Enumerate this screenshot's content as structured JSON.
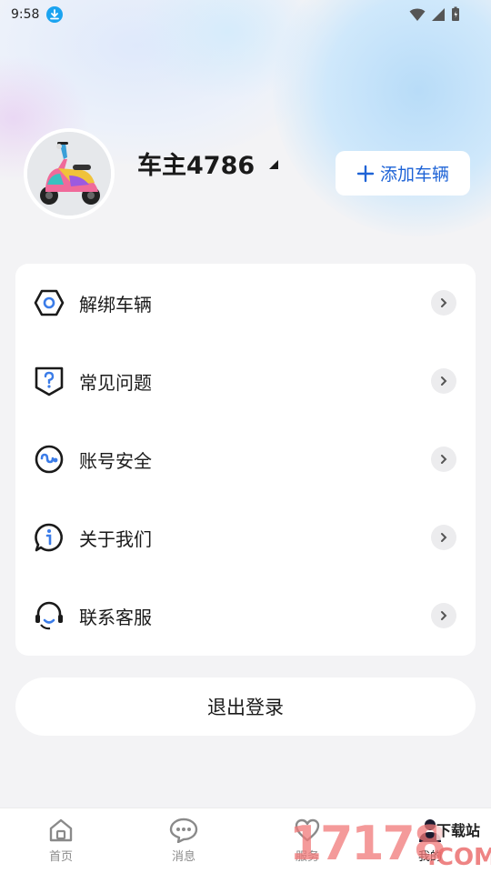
{
  "status_bar": {
    "time": "9:58"
  },
  "profile": {
    "username": "车主4786",
    "add_vehicle_label": "添加车辆"
  },
  "menu": {
    "items": [
      {
        "label": "解绑车辆",
        "icon": "unbind-vehicle-icon"
      },
      {
        "label": "常见问题",
        "icon": "faq-icon"
      },
      {
        "label": "账号安全",
        "icon": "account-security-icon"
      },
      {
        "label": "关于我们",
        "icon": "about-us-icon"
      },
      {
        "label": "联系客服",
        "icon": "customer-service-icon"
      }
    ]
  },
  "logout_label": "退出登录",
  "tabbar": {
    "tabs": [
      {
        "label": "首页",
        "icon": "home-icon"
      },
      {
        "label": "消息",
        "icon": "message-icon"
      },
      {
        "label": "服务",
        "icon": "service-icon"
      },
      {
        "label": "我的",
        "icon": "profile-icon",
        "active": true
      }
    ]
  },
  "watermark": {
    "number": "17178",
    "top_text": "下载站",
    "suffix": ".COM"
  },
  "colors": {
    "accent": "#1e63d6",
    "background": "#f3f3f5",
    "card": "#ffffff"
  }
}
